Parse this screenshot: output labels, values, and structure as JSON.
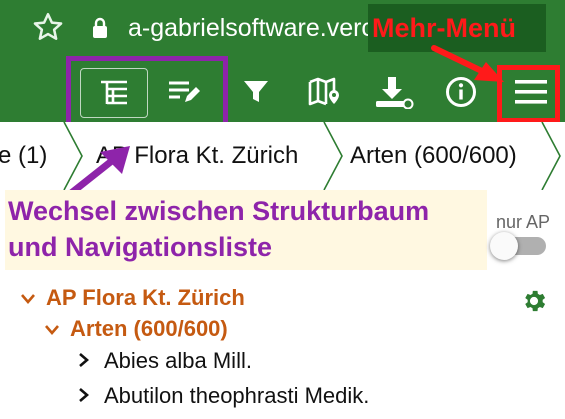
{
  "browser": {
    "url": "a-gabrielsoftware.verce"
  },
  "annotations": {
    "menu_label": "Mehr-Menü",
    "switch_note_line1": "Wechsel zwischen Strukturbaum",
    "switch_note_line2": "und Navigationsliste"
  },
  "toolbar": {
    "icons": [
      "tree-icon",
      "list-edit-icon",
      "filter-icon",
      "map-icon",
      "download-icon",
      "info-icon",
      "menu-icon"
    ]
  },
  "breadcrumbs": [
    {
      "label": "e (1)"
    },
    {
      "label": "AP Flora Kt. Zürich"
    },
    {
      "label": "Arten (600/600)"
    }
  ],
  "filter": {
    "nur_ap_label": "nur AP",
    "nur_ap_checked": false
  },
  "tree": {
    "root": {
      "label": "AP Flora Kt. Zürich"
    },
    "group": {
      "label": "Arten (600/600)"
    },
    "items": [
      {
        "label": "Abies alba Mill."
      },
      {
        "label": "Abutilon theophrasti Medik."
      }
    ]
  },
  "colors": {
    "primary": "#2e7d32",
    "tree_accent": "#c55a11",
    "annotation_purple": "#8e24aa",
    "annotation_red": "#ff1a1a"
  }
}
